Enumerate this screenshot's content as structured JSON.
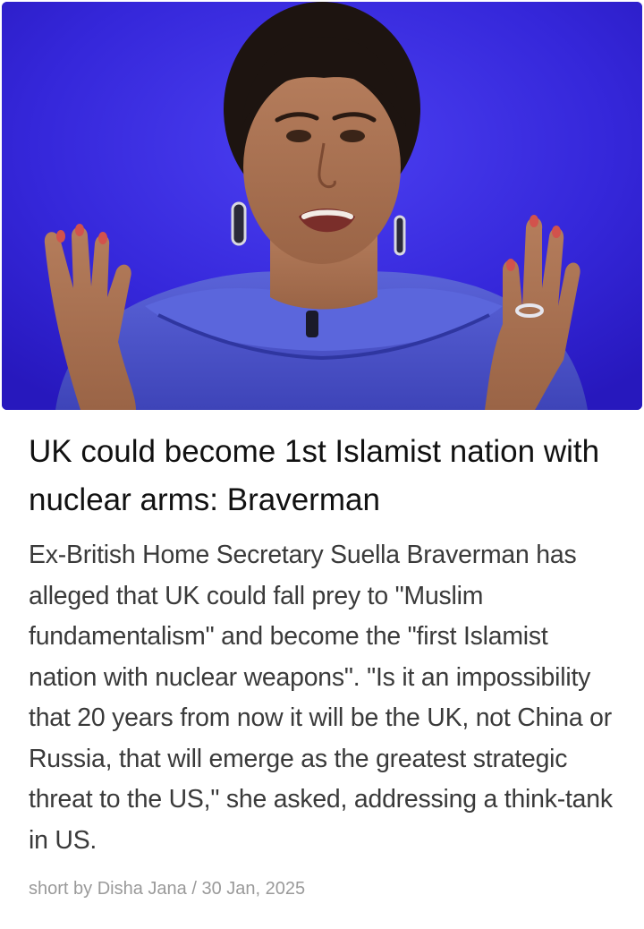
{
  "article": {
    "image_alt": "Suella Braverman speaking with raised hands against a blue background",
    "headline": "UK could become 1st Islamist nation with nuclear arms: Braverman",
    "body": "Ex-British Home Secretary Suella Braverman has alleged that UK could fall prey to \"Muslim fundamentalism\" and become the \"first Islamist nation with nuclear weapons\". \"Is it an impossibility that 20 years from now it will be the UK, not China or Russia, that will emerge as the greatest strategic threat to the US,\" she asked, addressing a think-tank in US.",
    "byline_prefix": "short by",
    "author": "Disha Jana",
    "separator": "/",
    "date": "30 Jan, 2025"
  },
  "colors": {
    "background": "#ffffff",
    "hero_blue": "#3425d9",
    "headline": "#111111",
    "body": "#3a3a3a",
    "byline": "#9a9a9a"
  }
}
